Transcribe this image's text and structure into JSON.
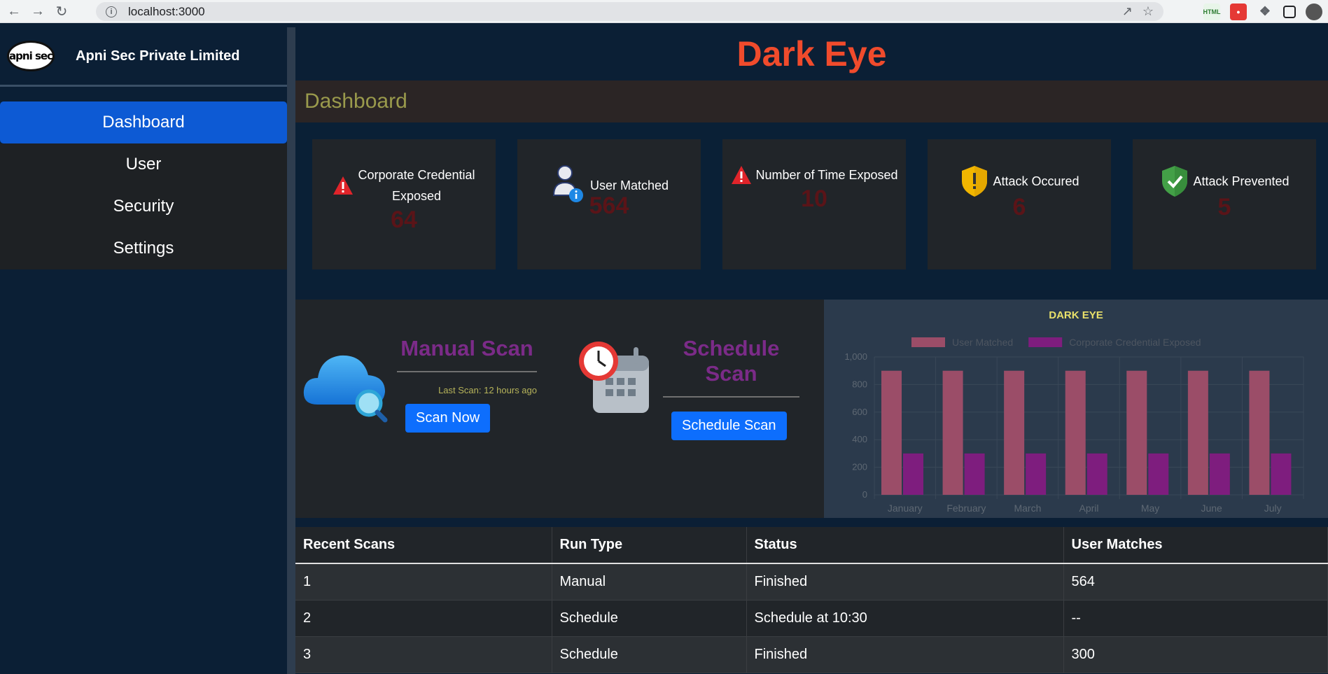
{
  "browser": {
    "url": "localhost:3000"
  },
  "brand": {
    "logo_text": "apni sec",
    "name": "Apni Sec Private Limited"
  },
  "sidebar": {
    "items": [
      {
        "label": "Dashboard",
        "active": true
      },
      {
        "label": "User",
        "active": false
      },
      {
        "label": "Security",
        "active": false
      },
      {
        "label": "Settings",
        "active": false
      }
    ]
  },
  "header": {
    "title": "Dark Eye",
    "section": "Dashboard"
  },
  "cards": [
    {
      "label": "Corporate Credential Exposed",
      "value": "64",
      "icon": "warning-icon"
    },
    {
      "label": "User Matched",
      "value": "564",
      "icon": "user-info-icon"
    },
    {
      "label": "Number of Time Exposed",
      "value": "10",
      "icon": "warning-icon"
    },
    {
      "label": "Attack Occured",
      "value": "6",
      "icon": "shield-alert-icon"
    },
    {
      "label": "Attack Prevented",
      "value": "5",
      "icon": "shield-check-icon"
    }
  ],
  "manual_scan": {
    "title": "Manual Scan",
    "last_scan": "Last Scan: 12 hours ago",
    "button": "Scan Now",
    "icon": "cloud-search-icon"
  },
  "schedule_scan": {
    "title": "Schedule Scan",
    "button": "Schedule Scan",
    "icon": "clock-calendar-icon"
  },
  "chart_data": {
    "type": "bar",
    "title": "DARK EYE",
    "categories": [
      "January",
      "February",
      "March",
      "April",
      "May",
      "June",
      "July"
    ],
    "series": [
      {
        "name": "User Matched",
        "values": [
          900,
          900,
          900,
          900,
          900,
          900,
          900
        ],
        "color": "#9b4d68"
      },
      {
        "name": "Corporate Credential Exposed",
        "values": [
          300,
          300,
          300,
          300,
          300,
          300,
          300
        ],
        "color": "#7e1d7e"
      }
    ],
    "yticks": [
      "0",
      "200",
      "400",
      "600",
      "800",
      "1,000"
    ],
    "ylim": [
      0,
      1000
    ],
    "legend": "top",
    "grid": true
  },
  "table": {
    "headers": [
      "Recent Scans",
      "Run Type",
      "Status",
      "User Matches"
    ],
    "rows": [
      [
        "1",
        "Manual",
        "Finished",
        "564"
      ],
      [
        "2",
        "Schedule",
        "Schedule at 10:30",
        "--"
      ],
      [
        "3",
        "Schedule",
        "Finished",
        "300"
      ]
    ]
  }
}
